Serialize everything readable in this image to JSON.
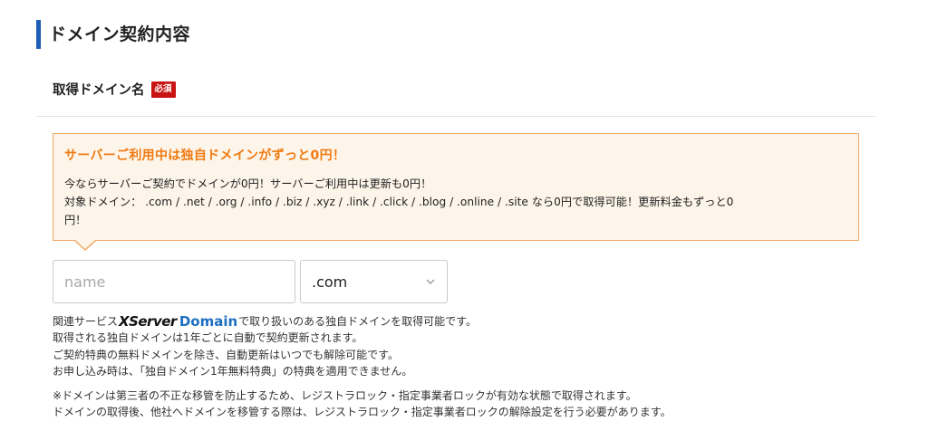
{
  "section": {
    "title": "ドメイン契約内容"
  },
  "field": {
    "label": "取得ドメイン名",
    "required_badge": "必須"
  },
  "promo": {
    "title": "サーバーご利用中は独自ドメインがずっと0円！",
    "line1": "今ならサーバーご契約でドメインが0円！サーバーご利用中は更新も0円！",
    "line2": "対象ドメイン： .com / .net / .org / .info / .biz / .xyz / .link / .click / .blog / .online / .site なら0円で取得可能！更新料金もずっと0",
    "line3": "円！",
    "accent_color": "#f07a12"
  },
  "domain_input": {
    "placeholder": "name",
    "value": ""
  },
  "tld_select": {
    "selected": ".com"
  },
  "notes": {
    "line1_prefix": "関連サービス",
    "brand_x": "XServer",
    "brand_domain": "Domain",
    "line1_suffix": "で取り扱いのある独自ドメインを取得可能です。",
    "line2": "取得される独自ドメインは1年ごとに自動で契約更新されます。",
    "line3": "ご契約特典の無料ドメインを除き、自動更新はいつでも解除可能です。",
    "line4": "お申し込み時は、「独自ドメイン1年無料特典」の特典を適用できません。"
  },
  "cautions": {
    "line1": "※ドメインは第三者の不正な移管を防止するため、レジストラロック・指定事業者ロックが有効な状態で取得されます。",
    "line2": "ドメインの取得後、他社へドメインを移管する際は、レジストラロック・指定事業者ロックの解除設定を行う必要があります。"
  },
  "colors": {
    "section_bar": "#1a5fb4",
    "required": "#c91414",
    "brand_domain": "#1d6fc1"
  },
  "icons": {
    "select_arrow": "chevron-down-icon"
  }
}
